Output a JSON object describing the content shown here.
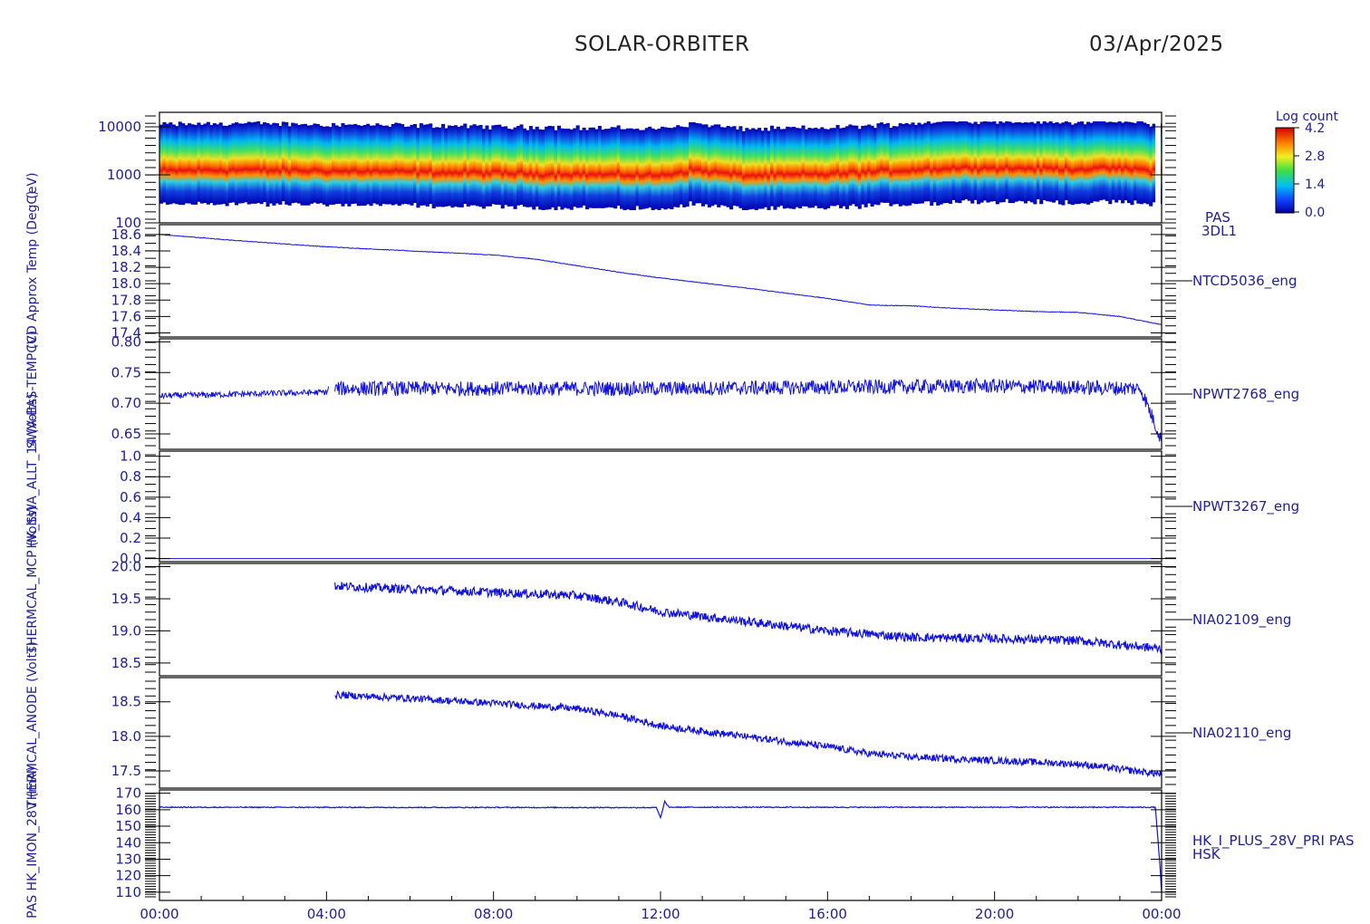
{
  "header": {
    "mission": "SOLAR-ORBITER",
    "date": "03/Apr/2025"
  },
  "chart_data": {
    "type": "line",
    "x_axis": {
      "ticks": [
        "00:00",
        "04:00",
        "08:00",
        "12:00",
        "16:00",
        "20:00",
        "00:00"
      ],
      "range_hours": [
        0,
        24
      ]
    },
    "left_axis_labels": [
      "(eV)",
      "CCD Approx Temp (DegC)",
      "SWA-EAS-TEMP (V)",
      "HK_SWA_ALLT_14 (Volts)",
      "THERMCAL_MCP (Volts)",
      "THERMCAL_ANODE (Volts)",
      "PAS HK_IMON_28V (mA)"
    ],
    "panels": [
      {
        "id": "pas-energy-spectrogram",
        "type": "heatmap",
        "right_label": "PAS",
        "right_sublabel": "3DL1",
        "y_scale": "log",
        "y_range": [
          100,
          20000
        ],
        "y_ticks": [
          "10000",
          "1000",
          "100"
        ],
        "y_tick_values": [
          10000,
          1000,
          100
        ],
        "colorbar": {
          "title": "Log count",
          "ticks": [
            "4.2",
            "2.8",
            "1.4",
            "0.0"
          ],
          "range": [
            0.0,
            4.2
          ]
        },
        "peak_energy_eV": [
          [
            0,
            1000
          ],
          [
            2,
            1050
          ],
          [
            4,
            1000
          ],
          [
            6,
            950
          ],
          [
            8,
            900
          ],
          [
            10,
            850
          ],
          [
            12,
            800
          ],
          [
            12.8,
            1050
          ],
          [
            14,
            800
          ],
          [
            16,
            850
          ],
          [
            18,
            1050
          ],
          [
            19.5,
            1200
          ],
          [
            20,
            1150
          ],
          [
            22,
            1100
          ],
          [
            22.8,
            1150
          ],
          [
            24,
            1000
          ]
        ]
      },
      {
        "id": "ntcd5036",
        "right_label": "NTCD5036_eng",
        "y_range": [
          17.35,
          18.72
        ],
        "y_ticks": [
          "18.6",
          "18.4",
          "18.2",
          "18.0",
          "17.8",
          "17.6",
          "17.4"
        ],
        "y_tick_values": [
          18.6,
          18.4,
          18.2,
          18.0,
          17.8,
          17.6,
          17.4
        ],
        "series": [
          {
            "x": [
              0,
              2,
              4,
              6,
              8,
              9,
              10,
              11,
              12,
              14,
              16,
              17,
              18,
              19,
              20,
              21,
              22,
              23,
              24
            ],
            "y": [
              18.6,
              18.52,
              18.45,
              18.4,
              18.35,
              18.3,
              18.22,
              18.14,
              18.07,
              17.95,
              17.82,
              17.74,
              17.73,
              17.7,
              17.68,
              17.66,
              17.65,
              17.6,
              17.5
            ],
            "noise": 0.004
          }
        ]
      },
      {
        "id": "npwt2768",
        "right_label": "NPWT2768_eng",
        "y_range": [
          0.625,
          0.805
        ],
        "y_ticks": [
          "0.80",
          "0.75",
          "0.70",
          "0.65"
        ],
        "y_tick_values": [
          0.8,
          0.75,
          0.7,
          0.65
        ],
        "series": [
          {
            "x": [
              0,
              4,
              4.05
            ],
            "y": [
              0.712,
              0.718,
              0.724
            ],
            "noise": 0.005,
            "seg": "quiet"
          },
          {
            "x": [
              4.2,
              8,
              12,
              16,
              19.5,
              20,
              23.5,
              24
            ],
            "y": [
              0.724,
              0.724,
              0.724,
              0.726,
              0.728,
              0.728,
              0.724,
              0.64
            ],
            "noise": 0.012,
            "seg": "noisy"
          }
        ]
      },
      {
        "id": "npwt3267",
        "right_label": "NPWT3267_eng",
        "y_range": [
          -0.03,
          1.05
        ],
        "y_ticks": [
          "1.0",
          "0.8",
          "0.6",
          "0.4",
          "0.2",
          "0.0"
        ],
        "y_tick_values": [
          1.0,
          0.8,
          0.6,
          0.4,
          0.2,
          0.0
        ],
        "series": [
          {
            "x": [
              0,
              24
            ],
            "y": [
              0.0,
              0.0
            ],
            "noise": 0.0
          }
        ]
      },
      {
        "id": "nia02109",
        "right_label": "NIA02109_eng",
        "y_range": [
          18.3,
          20.05
        ],
        "y_ticks": [
          "20.0",
          "19.5",
          "19.0",
          "18.5"
        ],
        "y_tick_values": [
          20.0,
          19.5,
          19.0,
          18.5
        ],
        "series": [
          {
            "x": [
              4.2,
              6,
              8,
              10,
              11,
              12,
              14,
              16,
              17,
              18,
              20,
              22,
              24
            ],
            "y": [
              19.7,
              19.65,
              19.6,
              19.55,
              19.45,
              19.3,
              19.15,
              19.0,
              18.95,
              18.9,
              18.88,
              18.85,
              18.72
            ],
            "noise": 0.07
          }
        ]
      },
      {
        "id": "nia02110",
        "right_label": "NIA02110_eng",
        "y_range": [
          17.25,
          18.85
        ],
        "y_ticks": [
          "18.5",
          "18.0",
          "17.5"
        ],
        "y_tick_values": [
          18.5,
          18.0,
          17.5
        ],
        "series": [
          {
            "x": [
              4.2,
              6,
              8,
              10,
              11,
              12,
              14,
              16,
              17,
              18,
              20,
              22,
              24
            ],
            "y": [
              18.6,
              18.55,
              18.48,
              18.4,
              18.3,
              18.15,
              18.0,
              17.85,
              17.75,
              17.7,
              17.65,
              17.6,
              17.45
            ],
            "noise": 0.05
          }
        ]
      },
      {
        "id": "pas-hk-imon-28v",
        "right_label": "HK_I_PLUS_28V_PRI PAS",
        "right_sublabel": "HSK",
        "y_range": [
          105,
          172
        ],
        "y_ticks": [
          "170",
          "160",
          "150",
          "140",
          "130",
          "120",
          "110"
        ],
        "y_tick_values": [
          170,
          160,
          150,
          140,
          130,
          120,
          110
        ],
        "series": [
          {
            "x": [
              0,
              11.9,
              12.0,
              12.1,
              12.2,
              23.85,
              23.95,
              24
            ],
            "y": [
              161.5,
              161.3,
              155,
              165,
              161.5,
              161.5,
              130,
              110
            ],
            "noise": 0.3
          }
        ]
      }
    ]
  }
}
